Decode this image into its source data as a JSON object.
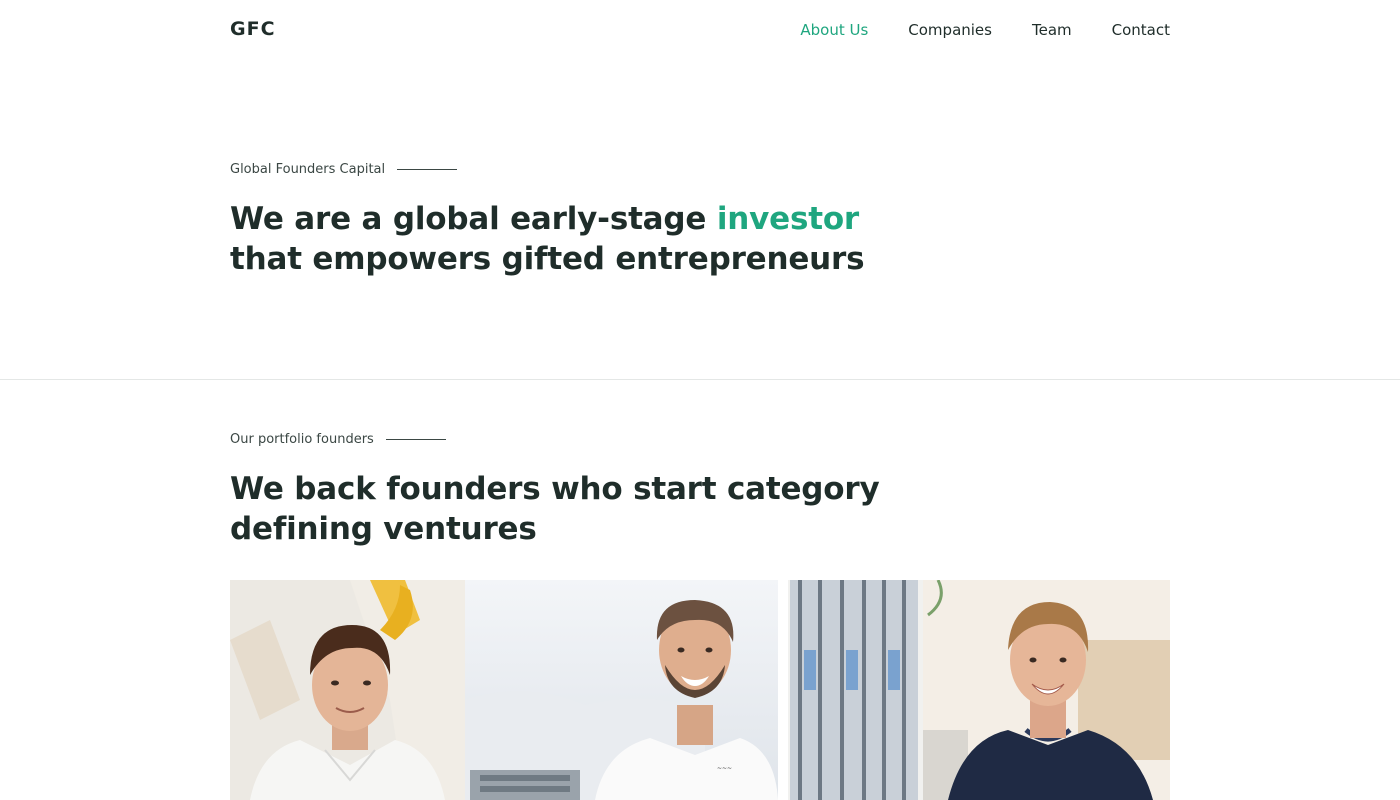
{
  "header": {
    "logo": "GFC",
    "nav": [
      {
        "label": "About Us",
        "active": true
      },
      {
        "label": "Companies",
        "active": false
      },
      {
        "label": "Team",
        "active": false
      },
      {
        "label": "Contact",
        "active": false
      }
    ]
  },
  "hero": {
    "eyebrow": "Global Founders Capital",
    "headline_before": "We are a global early-stage ",
    "headline_accent": "investor",
    "headline_after": " that empowers gifted entrepreneurs"
  },
  "portfolio": {
    "eyebrow": "Our portfolio founders",
    "headline": "We back founders who start category defining ventures"
  },
  "photos": [
    {
      "icon": "founder-portrait-1"
    },
    {
      "icon": "founder-portrait-2"
    },
    {
      "icon": "founder-portrait-3"
    }
  ],
  "colors": {
    "accent": "#1fa67f",
    "text": "#1f2d2a"
  }
}
